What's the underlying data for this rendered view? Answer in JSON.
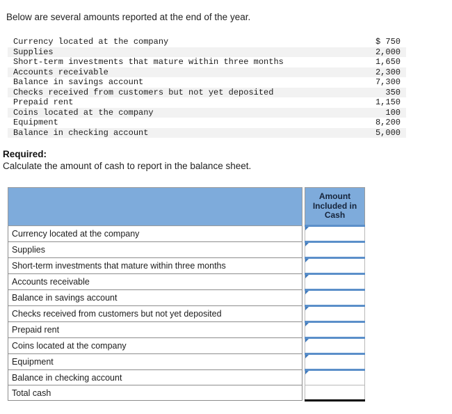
{
  "intro": "Below are several amounts reported at the end of the year.",
  "amounts_table": {
    "rows": [
      {
        "label": "Currency located at the company",
        "amount": "$ 750"
      },
      {
        "label": "Supplies",
        "amount": "2,000"
      },
      {
        "label": "Short-term investments that mature within three months",
        "amount": "1,650"
      },
      {
        "label": "Accounts receivable",
        "amount": "2,300"
      },
      {
        "label": "Balance in savings account",
        "amount": "7,300"
      },
      {
        "label": "Checks received from customers but not yet deposited",
        "amount": "350"
      },
      {
        "label": "Prepaid rent",
        "amount": "1,150"
      },
      {
        "label": "Coins located at the company",
        "amount": "100"
      },
      {
        "label": "Equipment",
        "amount": "8,200"
      },
      {
        "label": "Balance in checking account",
        "amount": "5,000"
      }
    ]
  },
  "required": {
    "label": "Required:",
    "text": "Calculate the amount of cash to report in the balance sheet."
  },
  "answer_table": {
    "header": {
      "blank": "",
      "amount_line1": "Amount",
      "amount_line2": "Included in",
      "amount_line3": "Cash"
    },
    "rows": [
      {
        "label": "Currency located at the company",
        "value": ""
      },
      {
        "label": "Supplies",
        "value": ""
      },
      {
        "label": "Short-term investments that mature within three months",
        "value": ""
      },
      {
        "label": "Accounts receivable",
        "value": ""
      },
      {
        "label": "Balance in savings account",
        "value": ""
      },
      {
        "label": "Checks received from customers but not yet deposited",
        "value": ""
      },
      {
        "label": "Prepaid rent",
        "value": ""
      },
      {
        "label": "Coins located at the company",
        "value": ""
      },
      {
        "label": "Equipment",
        "value": ""
      },
      {
        "label": "Balance in checking account",
        "value": ""
      }
    ],
    "total_row": {
      "label": "Total cash",
      "value": ""
    }
  },
  "colors": {
    "header_blue": "#7eabdb",
    "cell_top_blue": "#5b8fc9",
    "marker_blue": "#3f7bbf",
    "stripe_gray": "#f2f2f2",
    "total_rule": "#000000"
  }
}
